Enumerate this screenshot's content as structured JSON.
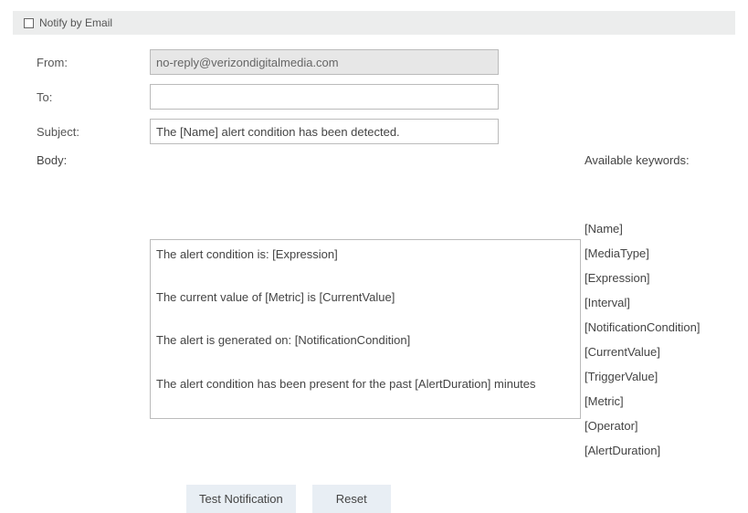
{
  "header": {
    "checkbox_label": "Notify by Email"
  },
  "form": {
    "from_label": "From:",
    "from_value": "no-reply@verizondigitalmedia.com",
    "to_label": "To:",
    "to_value": "",
    "subject_label": "Subject:",
    "subject_value": "The [Name] alert condition has been detected.",
    "body_label": "Body:",
    "body_value": "The alert condition is: [Expression]\n\nThe current value of [Metric] is [CurrentValue]\n\nThe alert is generated on: [NotificationCondition]\n\nThe alert condition has been present for the past [AlertDuration] minutes"
  },
  "keywords": {
    "title": "Available keywords:",
    "items": [
      "[Name]",
      "[MediaType]",
      "[Expression]",
      "[Interval]",
      "[NotificationCondition]",
      "[CurrentValue]",
      "[TriggerValue]",
      "[Metric]",
      "[Operator]",
      "[AlertDuration]"
    ]
  },
  "buttons": {
    "test": "Test Notification",
    "reset": "Reset"
  }
}
